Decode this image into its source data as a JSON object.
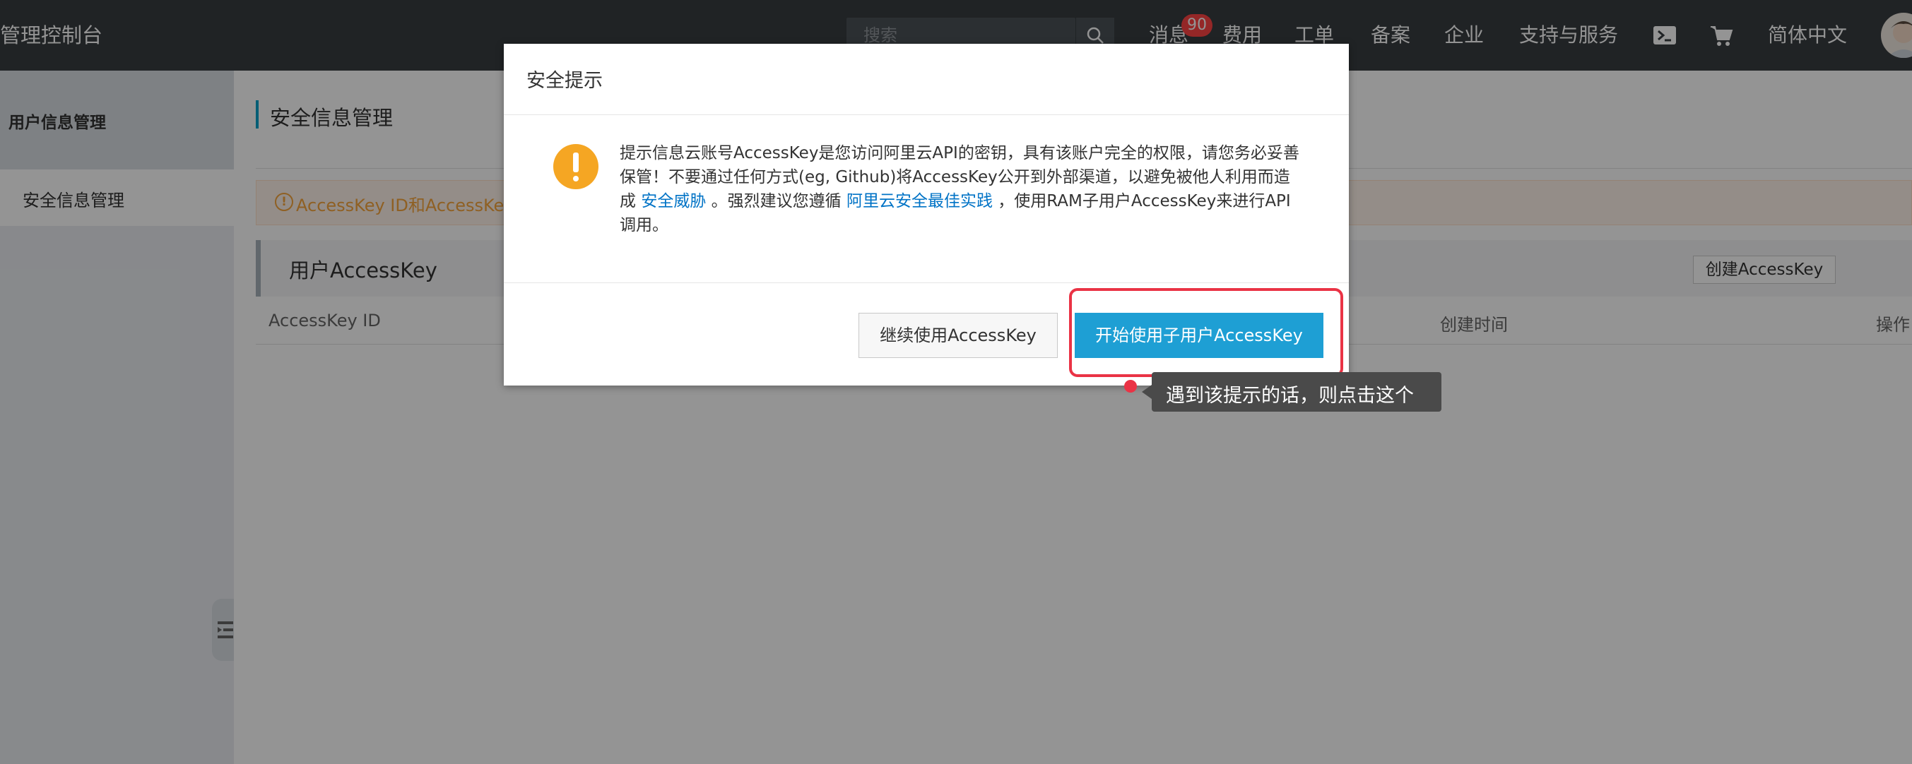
{
  "header": {
    "brand": "管理控制台",
    "search_placeholder": "搜索",
    "nav": {
      "messages": "消息",
      "messages_badge": "90",
      "billing": "费用",
      "tickets": "工单",
      "icp": "备案",
      "enterprise": "企业",
      "support": "支持与服务",
      "language": "简体中文"
    }
  },
  "sidebar": {
    "title": "用户信息管理",
    "items": [
      {
        "label": "安全信息管理"
      }
    ]
  },
  "main": {
    "page_title": "安全信息管理",
    "warning_text": "AccessKey ID和AccessKey",
    "panel_title": "用户AccessKey",
    "create_button": "创建AccessKey",
    "columns": {
      "id": "AccessKey ID",
      "created": "创建时间",
      "actions": "操作"
    }
  },
  "dialog": {
    "title": "安全提示",
    "body_prefix": "提示信息云账号AccessKey是您访问阿里云API的密钥，具有该账户完全的权限，请您务必妥善保管！不要通过任何方式(eg, Github)将AccessKey公开到外部渠道，以避免被他人利用而造成",
    "link_threat": "安全威胁",
    "body_middle": "。强烈建议您遵循",
    "link_best_practice": "阿里云安全最佳实践",
    "body_suffix": "，使用RAM子用户AccessKey来进行API调用。",
    "continue_button": "继续使用AccessKey",
    "start_button": "开始使用子用户AccessKey"
  },
  "annotation": {
    "tooltip": "遇到该提示的话，则点击这个"
  },
  "colors": {
    "topbar": "#373d41",
    "primary_button": "#1e9fd4",
    "link": "#0073c6",
    "warning": "#f5a623",
    "highlight": "#ea3345"
  }
}
